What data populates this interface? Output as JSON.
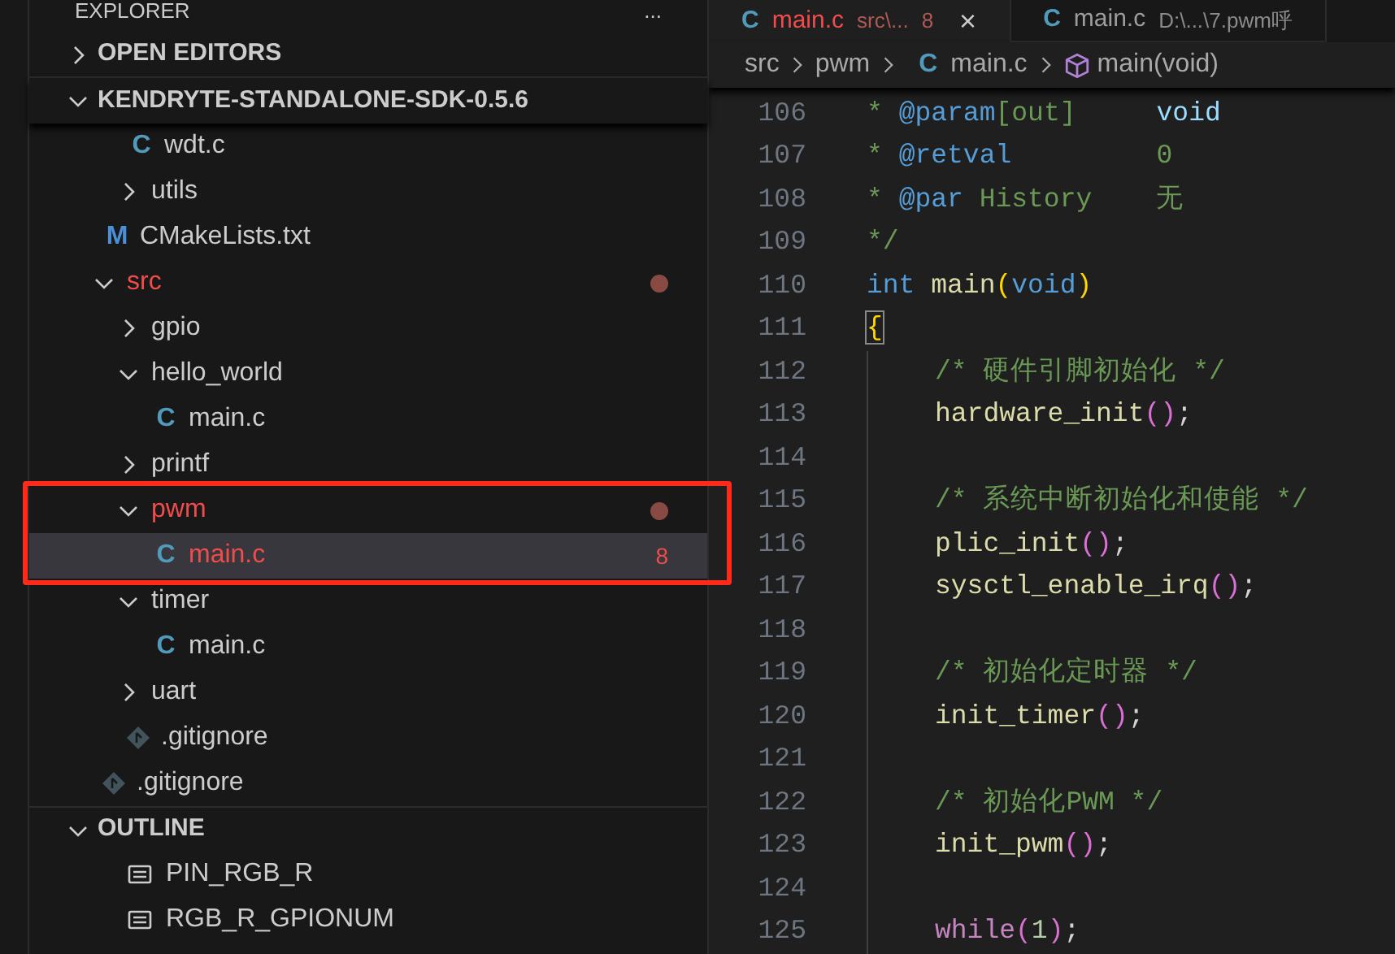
{
  "sidebar": {
    "title": "EXPLORER",
    "more": "...",
    "sections": [
      {
        "label": "OPEN EDITORS",
        "expanded": false
      },
      {
        "label": "KENDRYTE-STANDALONE-SDK-0.5.6",
        "expanded": true
      }
    ],
    "tree": [
      {
        "label": "wdt.c",
        "kind": "c-file",
        "icon": "C",
        "nested": true,
        "selected": false
      },
      {
        "label": "utils",
        "kind": "folder",
        "expanded": false,
        "nested": true,
        "selected": false
      },
      {
        "label": "CMakeLists.txt",
        "kind": "cmake-file",
        "icon": "M",
        "selected": false
      },
      {
        "label": "src",
        "kind": "folder",
        "expanded": true,
        "modified": true,
        "selected": false,
        "children": [
          {
            "label": "gpio",
            "kind": "folder",
            "expanded": false,
            "selected": false
          },
          {
            "label": "hello_world",
            "kind": "folder",
            "expanded": true,
            "selected": false,
            "children": [
              {
                "label": "main.c",
                "kind": "c-file",
                "icon": "C",
                "selected": false
              }
            ]
          },
          {
            "label": "printf",
            "kind": "folder",
            "expanded": false,
            "selected": false
          },
          {
            "label": "pwm",
            "kind": "folder",
            "expanded": true,
            "modified": true,
            "annotated": true,
            "selected": false,
            "children": [
              {
                "label": "main.c",
                "kind": "c-file",
                "icon": "C",
                "selected": true,
                "error": true,
                "badge": "8",
                "annotated": true
              }
            ]
          },
          {
            "label": "timer",
            "kind": "folder",
            "expanded": true,
            "selected": false,
            "children": [
              {
                "label": "main.c",
                "kind": "c-file",
                "icon": "C",
                "selected": false
              }
            ]
          },
          {
            "label": "uart",
            "kind": "folder",
            "expanded": false,
            "selected": false
          },
          {
            "label": ".gitignore",
            "kind": "git-file",
            "selected": false
          }
        ]
      },
      {
        "label": ".gitignore",
        "kind": "git-file",
        "selected": false
      }
    ],
    "outline": {
      "label": "OUTLINE",
      "expanded": true,
      "items": [
        "PIN_RGB_R",
        "RGB_R_GPIONUM"
      ]
    }
  },
  "editor": {
    "tabs": [
      {
        "icon": "C",
        "label": "main.c",
        "path": "src\\...",
        "badge": "8",
        "close": "×",
        "selected": true,
        "error": true
      },
      {
        "icon": "C",
        "label": "main.c",
        "path": "D:\\...\\7.pwm呼",
        "selected": false,
        "error": false
      }
    ],
    "breadcrumbs": [
      {
        "label": "src",
        "kind": "folder"
      },
      {
        "label": "pwm",
        "kind": "folder"
      },
      {
        "label": "main.c",
        "kind": "c-file",
        "icon": "C"
      },
      {
        "label": "main(void)",
        "kind": "symbol"
      }
    ],
    "lines": [
      {
        "number": "106",
        "tokens": [
          {
            "text": "* ",
            "kind": "comment"
          },
          {
            "text": "@param",
            "kind": "doc-tag"
          },
          {
            "text": "[out]     ",
            "kind": "comment"
          },
          {
            "text": "void",
            "kind": "variable"
          }
        ]
      },
      {
        "number": "107",
        "tokens": [
          {
            "text": "* ",
            "kind": "comment"
          },
          {
            "text": "@retval",
            "kind": "doc-tag"
          },
          {
            "text": "         0",
            "kind": "comment"
          }
        ]
      },
      {
        "number": "108",
        "tokens": [
          {
            "text": "* ",
            "kind": "comment"
          },
          {
            "text": "@par",
            "kind": "doc-tag"
          },
          {
            "text": " History    无",
            "kind": "comment"
          }
        ]
      },
      {
        "number": "109",
        "tokens": [
          {
            "text": "*/",
            "kind": "comment"
          }
        ]
      },
      {
        "number": "110",
        "tokens": [
          {
            "text": "int ",
            "kind": "keyword"
          },
          {
            "text": "main",
            "kind": "function"
          },
          {
            "text": "(",
            "kind": "bracket"
          },
          {
            "text": "void",
            "kind": "keyword"
          },
          {
            "text": ")",
            "kind": "bracket"
          }
        ]
      },
      {
        "number": "111",
        "tokens": [
          {
            "text": "{",
            "kind": "matched-bracket"
          }
        ]
      },
      {
        "number": "112",
        "indent": true,
        "tokens": [
          {
            "text": "/* 硬件引脚初始化 */",
            "kind": "comment"
          }
        ]
      },
      {
        "number": "113",
        "indent": true,
        "tokens": [
          {
            "text": "hardware_init",
            "kind": "function"
          },
          {
            "text": "(",
            "kind": "inner-bracket"
          },
          {
            "text": ")",
            "kind": "inner-bracket"
          },
          {
            "text": ";",
            "kind": "punctuation"
          }
        ]
      },
      {
        "number": "114",
        "indent": true
      },
      {
        "number": "115",
        "indent": true,
        "tokens": [
          {
            "text": "/* 系统中断初始化和使能 */",
            "kind": "comment"
          }
        ]
      },
      {
        "number": "116",
        "indent": true,
        "tokens": [
          {
            "text": "plic_init",
            "kind": "function"
          },
          {
            "text": "(",
            "kind": "inner-bracket"
          },
          {
            "text": ")",
            "kind": "inner-bracket"
          },
          {
            "text": ";",
            "kind": "punctuation"
          }
        ]
      },
      {
        "number": "117",
        "indent": true,
        "tokens": [
          {
            "text": "sysctl_enable_irq",
            "kind": "function"
          },
          {
            "text": "(",
            "kind": "inner-bracket"
          },
          {
            "text": ")",
            "kind": "inner-bracket"
          },
          {
            "text": ";",
            "kind": "punctuation"
          }
        ]
      },
      {
        "number": "118",
        "indent": true
      },
      {
        "number": "119",
        "indent": true,
        "tokens": [
          {
            "text": "/* 初始化定时器 */",
            "kind": "comment"
          }
        ]
      },
      {
        "number": "120",
        "indent": true,
        "tokens": [
          {
            "text": "init_timer",
            "kind": "function"
          },
          {
            "text": "(",
            "kind": "inner-bracket"
          },
          {
            "text": ")",
            "kind": "inner-bracket"
          },
          {
            "text": ";",
            "kind": "punctuation"
          }
        ]
      },
      {
        "number": "121",
        "indent": true
      },
      {
        "number": "122",
        "indent": true,
        "tokens": [
          {
            "text": "/* 初始化PWM */",
            "kind": "comment"
          }
        ]
      },
      {
        "number": "123",
        "indent": true,
        "tokens": [
          {
            "text": "init_pwm",
            "kind": "function"
          },
          {
            "text": "(",
            "kind": "inner-bracket"
          },
          {
            "text": ")",
            "kind": "inner-bracket"
          },
          {
            "text": ";",
            "kind": "punctuation"
          }
        ]
      },
      {
        "number": "124",
        "indent": true
      },
      {
        "number": "125",
        "indent": true,
        "tokens": [
          {
            "text": "while",
            "kind": "control"
          },
          {
            "text": "(",
            "kind": "inner-bracket"
          },
          {
            "text": "1",
            "kind": "number"
          },
          {
            "text": ")",
            "kind": "inner-bracket"
          },
          {
            "text": ";",
            "kind": "punctuation"
          }
        ]
      }
    ]
  }
}
